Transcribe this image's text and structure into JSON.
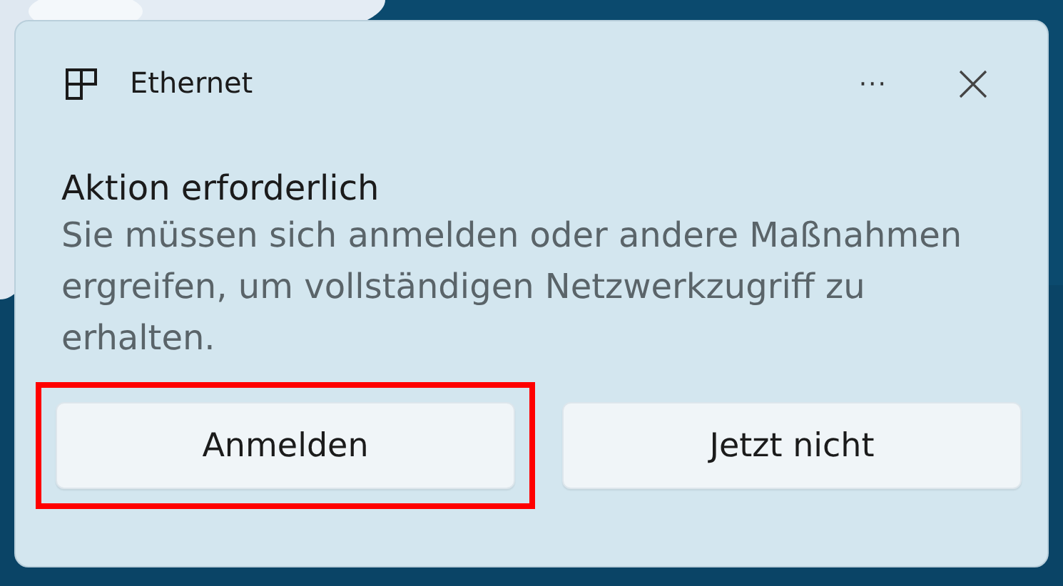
{
  "notification": {
    "app_name": "Ethernet",
    "more_button": "···",
    "title": "Aktion erforderlich",
    "message": "Sie müssen sich anmelden oder andere Maßnahmen ergreifen, um vollständigen Netzwerkzugriff zu erhalten."
  },
  "buttons": [
    {
      "label": "Anmelden",
      "highlighted": true
    },
    {
      "label": "Jetzt nicht",
      "highlighted": false
    }
  ]
}
